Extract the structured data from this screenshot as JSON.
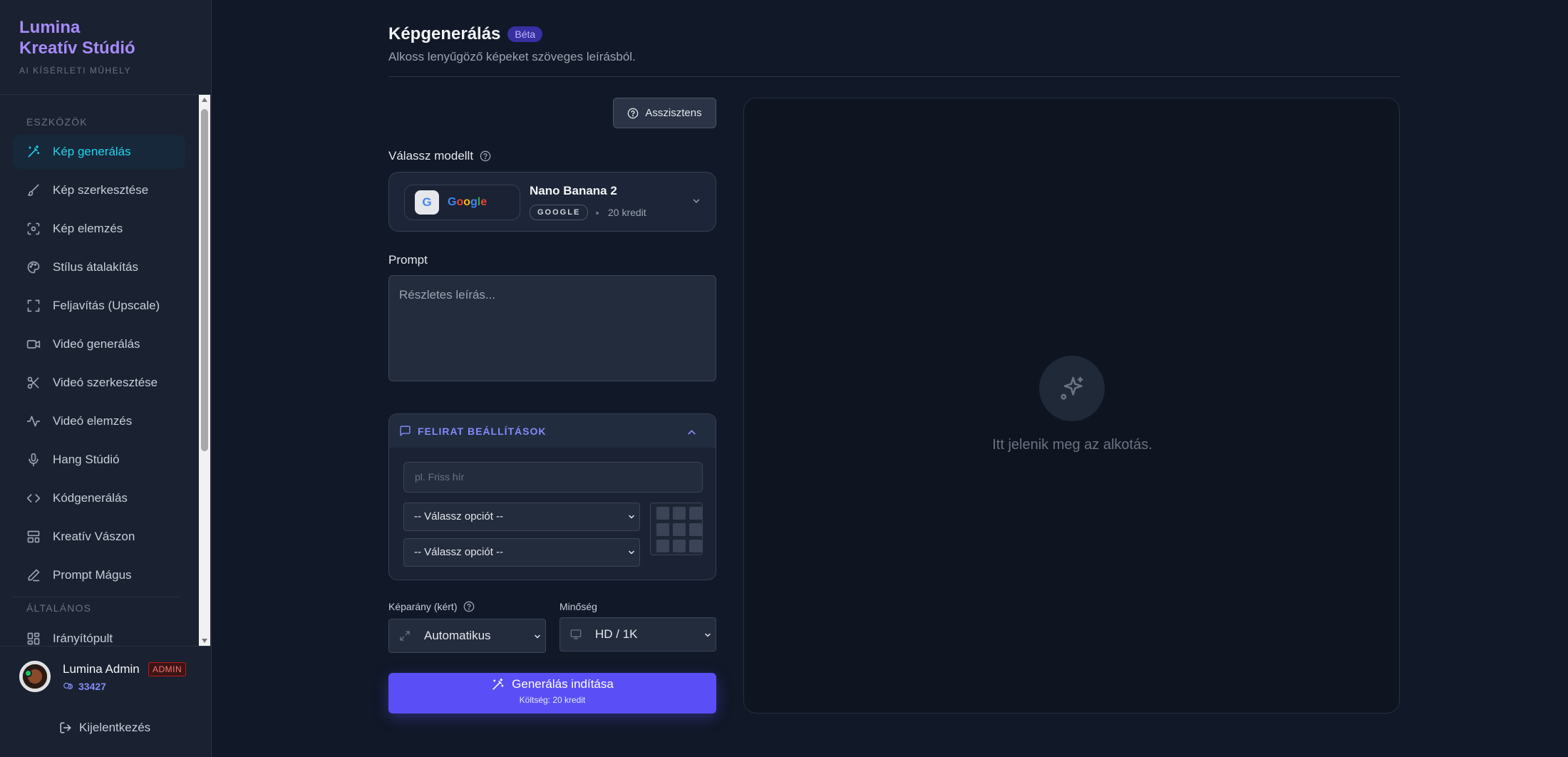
{
  "brand": {
    "title_line1": "Lumina",
    "title_line2": "Kreatív Stúdió",
    "subtitle": "AI KÍSÉRLETI MŰHELY"
  },
  "sidebar": {
    "section_tools": "ESZKÖZÖK",
    "section_general": "ÁLTALÁNOS",
    "items": [
      {
        "label": "Kép generálás",
        "icon": "magic-wand-icon",
        "active": true
      },
      {
        "label": "Kép szerkesztése",
        "icon": "brush-icon"
      },
      {
        "label": "Kép elemzés",
        "icon": "scan-eye-icon"
      },
      {
        "label": "Stílus átalakítás",
        "icon": "palette-icon"
      },
      {
        "label": "Feljavítás (Upscale)",
        "icon": "expand-frame-icon"
      },
      {
        "label": "Videó generálás",
        "icon": "video-icon"
      },
      {
        "label": "Videó szerkesztése",
        "icon": "scissors-icon"
      },
      {
        "label": "Videó elemzés",
        "icon": "activity-icon"
      },
      {
        "label": "Hang Stúdió",
        "icon": "microphone-icon"
      },
      {
        "label": "Kódgenerálás",
        "icon": "code-icon"
      },
      {
        "label": "Kreatív Vászon",
        "icon": "layout-icon"
      },
      {
        "label": "Prompt Mágus",
        "icon": "pen-icon"
      }
    ],
    "general_items": [
      {
        "label": "Irányítópult",
        "icon": "dashboard-icon"
      }
    ]
  },
  "user": {
    "name": "Lumina Admin",
    "badge": "ADMIN",
    "credits": "33427",
    "logout": "Kijelentkezés"
  },
  "header": {
    "title": "Képgenerálás",
    "badge": "Béta",
    "subtitle": "Alkoss lenyűgöző képeket szöveges leírásból."
  },
  "assistant_button": "Asszisztens",
  "model": {
    "label": "Válassz modellt",
    "provider_word": "Google",
    "provider_initial": "G",
    "name": "Nano Banana 2",
    "tag": "GOOGLE",
    "cost": "20 kredit"
  },
  "prompt": {
    "label": "Prompt",
    "placeholder": "Részletes leírás..."
  },
  "caption": {
    "title": "FELIRAT BEÁLLÍTÁSOK",
    "input_placeholder": "pl. Friss hír",
    "select1": "-- Válassz opciót --",
    "select2": "-- Válassz opciót --"
  },
  "aspect": {
    "label": "Képarány (kért)",
    "value": "Automatikus"
  },
  "quality": {
    "label": "Minőség",
    "value": "HD / 1K"
  },
  "generate": {
    "label": "Generálás indítása",
    "cost": "Költség: 20 kredit"
  },
  "preview": {
    "placeholder": "Itt jelenik meg az alkotás."
  },
  "colors": {
    "accent": "#5a4ff6",
    "active_nav": "#22d3ee",
    "brand": "#a78bfa",
    "background": "#111827"
  }
}
